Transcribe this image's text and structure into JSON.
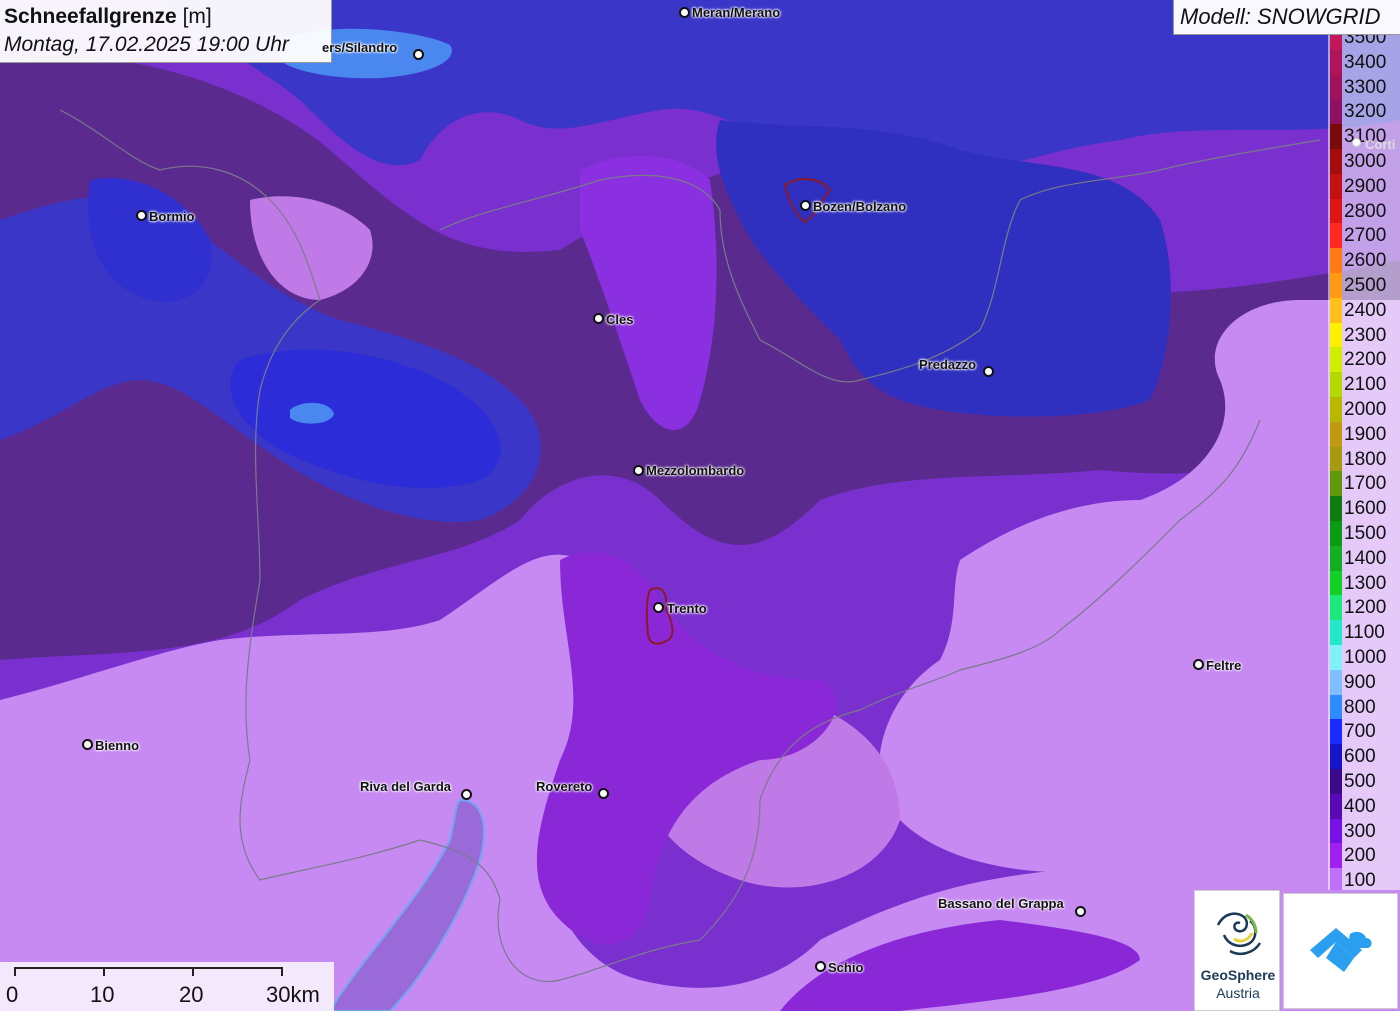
{
  "header": {
    "title_bold": "Schneefallgrenze",
    "title_unit": "[m]",
    "datetime": "Montag, 17.02.2025 19:00 Uhr"
  },
  "model": {
    "label": "Modell: SNOWGRID"
  },
  "legend": {
    "items": [
      {
        "label": "3500",
        "color": "#c2185b"
      },
      {
        "label": "3400",
        "color": "#b0155a"
      },
      {
        "label": "3300",
        "color": "#a0125a"
      },
      {
        "label": "3200",
        "color": "#8e1060"
      },
      {
        "label": "3100",
        "color": "#7a0a0a"
      },
      {
        "label": "3000",
        "color": "#a40d0d"
      },
      {
        "label": "2900",
        "color": "#c41010"
      },
      {
        "label": "2800",
        "color": "#e01515"
      },
      {
        "label": "2700",
        "color": "#ff2a1f"
      },
      {
        "label": "2600",
        "color": "#ff7a10"
      },
      {
        "label": "2500",
        "color": "#ff9a12"
      },
      {
        "label": "2400",
        "color": "#ffbf1a"
      },
      {
        "label": "2300",
        "color": "#fff000"
      },
      {
        "label": "2200",
        "color": "#d2ee00"
      },
      {
        "label": "2100",
        "color": "#b5d800"
      },
      {
        "label": "2000",
        "color": "#b8b800"
      },
      {
        "label": "1900",
        "color": "#c09a10"
      },
      {
        "label": "1800",
        "color": "#a89a10"
      },
      {
        "label": "1700",
        "color": "#5e9a0a"
      },
      {
        "label": "1600",
        "color": "#0f7a0f"
      },
      {
        "label": "1500",
        "color": "#0a9a14"
      },
      {
        "label": "1400",
        "color": "#10b020"
      },
      {
        "label": "1300",
        "color": "#14d024"
      },
      {
        "label": "1200",
        "color": "#1ce87a"
      },
      {
        "label": "1100",
        "color": "#22e8c8"
      },
      {
        "label": "1000",
        "color": "#7ef2f6"
      },
      {
        "label": "900",
        "color": "#7fbfff"
      },
      {
        "label": "800",
        "color": "#2f8cff"
      },
      {
        "label": "700",
        "color": "#1c2cff"
      },
      {
        "label": "600",
        "color": "#1414c8"
      },
      {
        "label": "500",
        "color": "#3a0a8a"
      },
      {
        "label": "400",
        "color": "#5a0ab4"
      },
      {
        "label": "300",
        "color": "#7a10e8"
      },
      {
        "label": "200",
        "color": "#a020f0"
      },
      {
        "label": "100",
        "color": "#c070f8"
      }
    ]
  },
  "cities": [
    {
      "name": "Meran/Merano",
      "dot": [
        684,
        12
      ],
      "label": [
        692,
        5
      ]
    },
    {
      "name": "ers/Silandro",
      "dot": [
        418,
        54
      ],
      "label": [
        322,
        40
      ]
    },
    {
      "name": "Bormio",
      "dot": [
        141,
        215
      ],
      "label": [
        149,
        209
      ]
    },
    {
      "name": "Bozen/Bolzano",
      "dot": [
        805,
        205
      ],
      "label": [
        813,
        199
      ]
    },
    {
      "name": "Cles",
      "dot": [
        598,
        318
      ],
      "label": [
        606,
        312
      ]
    },
    {
      "name": "Predazzo",
      "dot": [
        988,
        371
      ],
      "label": [
        919,
        357
      ]
    },
    {
      "name": "Mezzolombardo",
      "dot": [
        638,
        470
      ],
      "label": [
        646,
        463
      ]
    },
    {
      "name": "Trento",
      "dot": [
        658,
        607
      ],
      "label": [
        667,
        601
      ]
    },
    {
      "name": "Feltre",
      "dot": [
        1198,
        664
      ],
      "label": [
        1206,
        658
      ]
    },
    {
      "name": "Bienno",
      "dot": [
        87,
        744
      ],
      "label": [
        95,
        738
      ]
    },
    {
      "name": "Riva del Garda",
      "dot": [
        466,
        794
      ],
      "label": [
        360,
        779
      ]
    },
    {
      "name": "Rovereto",
      "dot": [
        603,
        793
      ],
      "label": [
        536,
        779
      ]
    },
    {
      "name": "Bassano del Grappa",
      "dot": [
        1080,
        911
      ],
      "label": [
        938,
        896
      ]
    },
    {
      "name": "Schio",
      "dot": [
        820,
        966
      ],
      "label": [
        828,
        960
      ]
    },
    {
      "name": "Corti",
      "dot": [
        1357,
        143
      ],
      "label": [
        1365,
        137
      ]
    }
  ],
  "scale": {
    "labels": [
      "0",
      "10",
      "20",
      "30km"
    ]
  },
  "logos": {
    "geosphere_line1": "GeoSphere",
    "geosphere_line2": "Austria"
  }
}
